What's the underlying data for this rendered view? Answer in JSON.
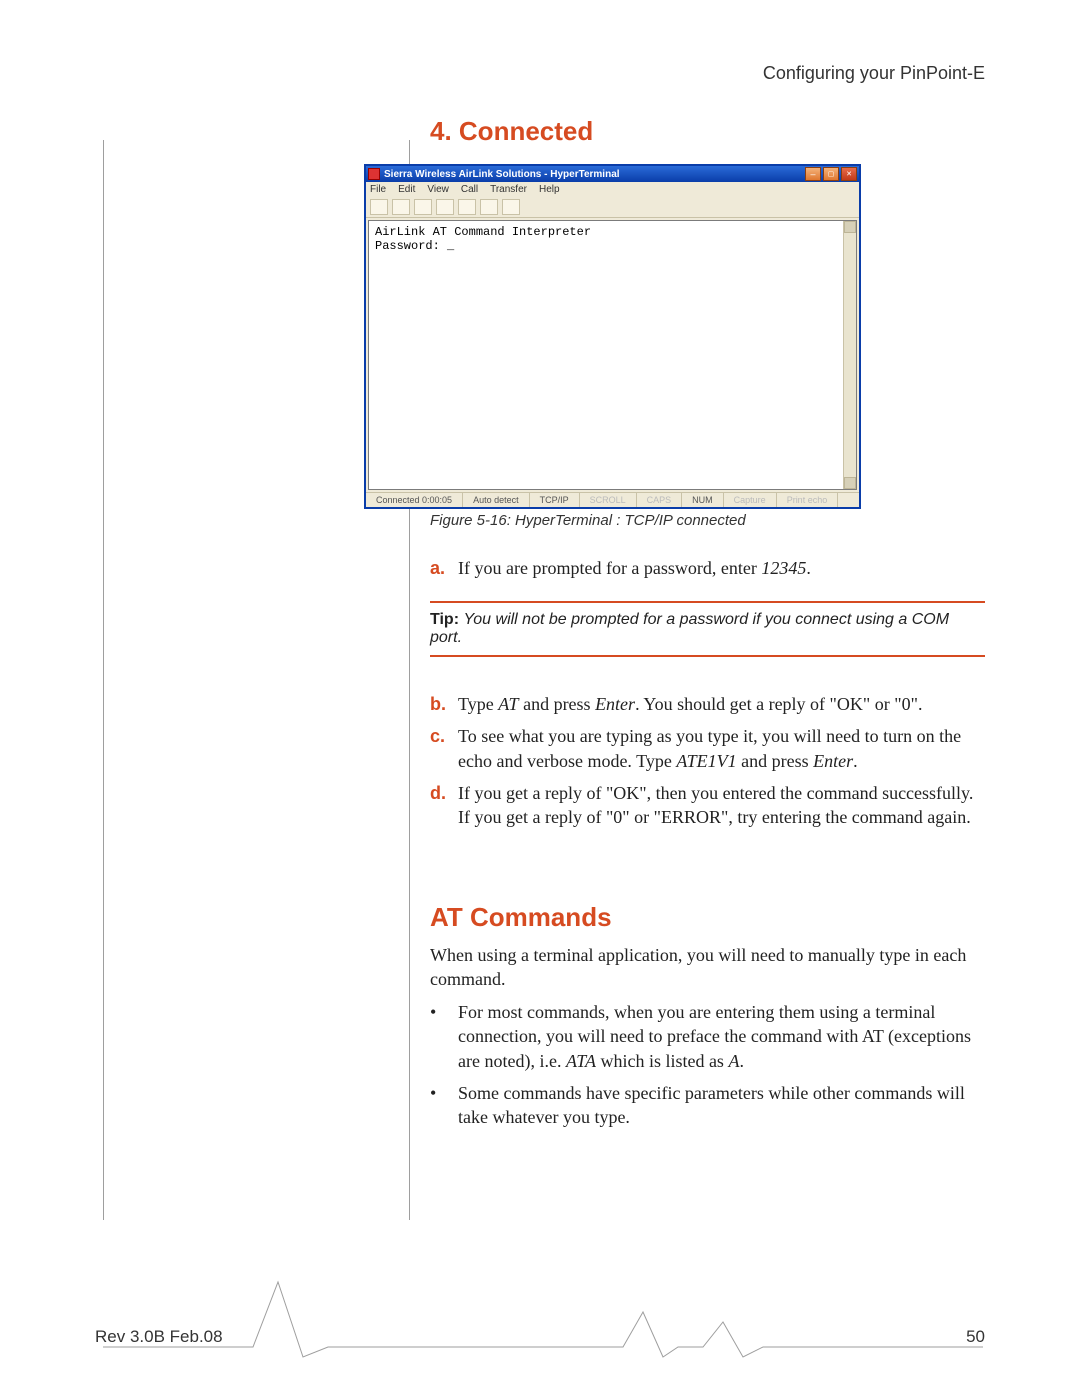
{
  "header": {
    "right": "Configuring your PinPoint-E"
  },
  "headings": {
    "connected": "4. Connected",
    "atCommands": "AT Commands"
  },
  "hyperterminal": {
    "title": "Sierra Wireless AirLink Solutions - HyperTerminal",
    "menu": [
      "File",
      "Edit",
      "View",
      "Call",
      "Transfer",
      "Help"
    ],
    "term_line1": "AirLink AT Command Interpreter",
    "term_line2": "Password: _",
    "status": {
      "conn": "Connected 0:00:05",
      "auto": "Auto detect",
      "proto": "TCP/IP",
      "scroll": "SCROLL",
      "caps": "CAPS",
      "num": "NUM",
      "capture": "Capture",
      "echo": "Print echo"
    }
  },
  "figure_caption": "Figure 5-16: HyperTerminal : TCP/IP connected",
  "steps": {
    "a": {
      "pre": "If you are prompted for a password, enter ",
      "cmd": "12345",
      "post": "."
    },
    "b": {
      "pre": "Type ",
      "cmd1": "AT",
      "mid": " and press ",
      "cmd2": "Enter",
      "post": ". You should get a reply of \"OK\" or \"0\"."
    },
    "c": {
      "pre": "To see what you are typing as you type it, you will need to turn on the echo and verbose mode. Type ",
      "cmd1": "ATE1V1",
      "mid": " and press ",
      "cmd2": "Enter",
      "post": "."
    },
    "d": "If you get a reply of \"OK\", then you entered the command successfully. If you get a reply of \"0\" or \"ERROR\", try entering the command again."
  },
  "tip": {
    "label": "Tip: ",
    "text": "You will not be prompted for a password if you connect using a COM port."
  },
  "at_intro": "When using a terminal application, you will need to manually type in each command.",
  "at_bullets": {
    "b1": {
      "pre": "For most commands, when you are entering them using a terminal connection, you will need to preface the command with AT (exceptions are noted), i.e. ",
      "cmd1": "ATA",
      "mid": " which is listed as ",
      "cmd2": "A",
      "post": "."
    },
    "b2": "Some commands have specific parameters while other commands will take whatever you type."
  },
  "footer": {
    "left": "Rev 3.0B  Feb.08",
    "right": "50"
  }
}
